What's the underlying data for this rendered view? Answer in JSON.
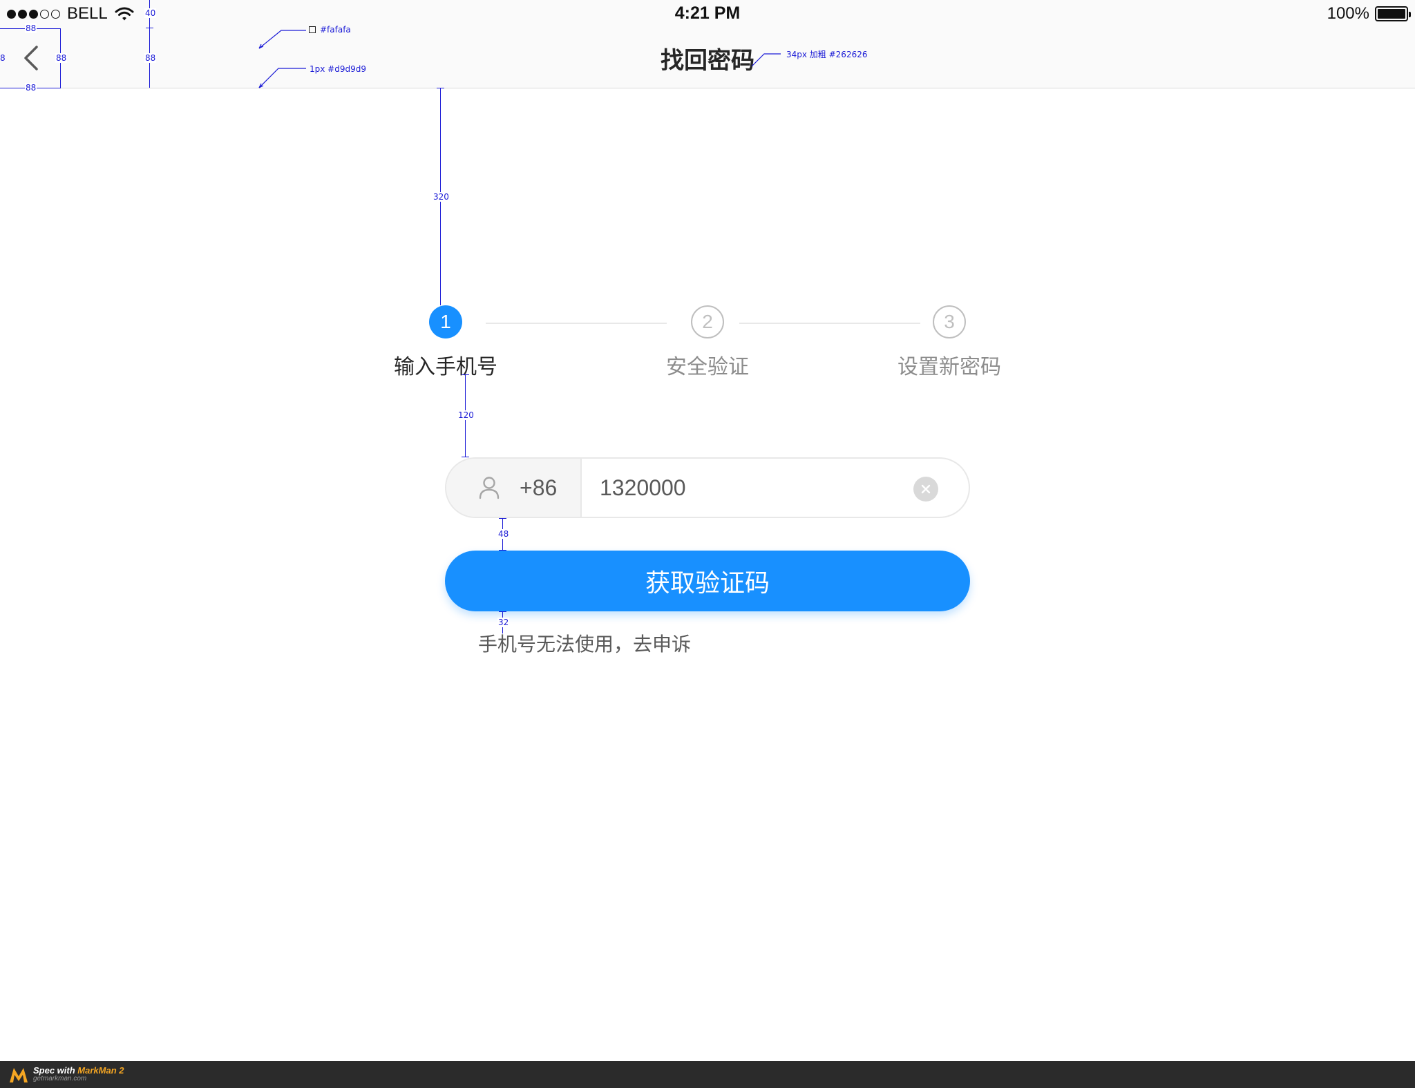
{
  "status_bar": {
    "carrier": "BELL",
    "time": "4:21 PM",
    "battery_percent": "100%",
    "battery_level": 1.0,
    "signal_bars_filled": 3,
    "signal_bars_total": 5
  },
  "nav": {
    "title": "找回密码",
    "back_icon": "chevron-left-icon"
  },
  "steps": [
    {
      "number": "1",
      "label": "输入手机号",
      "state": "active"
    },
    {
      "number": "2",
      "label": "安全验证",
      "state": "idle"
    },
    {
      "number": "3",
      "label": "设置新密码",
      "state": "idle"
    }
  ],
  "phone_form": {
    "user_icon": "user-icon",
    "country_code": "+86",
    "phone_value": "1320000",
    "clear_icon": "close-circle-icon"
  },
  "actions": {
    "get_code_label": "获取验证码",
    "appeal_link": "手机号无法使用，去申诉"
  },
  "spec_annotations": {
    "back_width": "88",
    "back_height": "88",
    "back_bottom": "88",
    "left_edge": "8",
    "status_height": "40",
    "nav_height": "88",
    "nav_bg": "#fafafa",
    "divider": "1px #d9d9d9",
    "title_spec": "34px 加粗 #262626",
    "gap_top": "320",
    "gap_steps_input": "120",
    "gap_input_button": "48",
    "gap_button_link": "32"
  },
  "colors": {
    "primary": "#1890ff",
    "nav_bg": "#fafafa",
    "divider": "#d9d9d9",
    "title": "#262626"
  },
  "footer": {
    "spec_prefix": "Spec with ",
    "brand": "MarkMan 2",
    "url": "getmarkman.com"
  }
}
